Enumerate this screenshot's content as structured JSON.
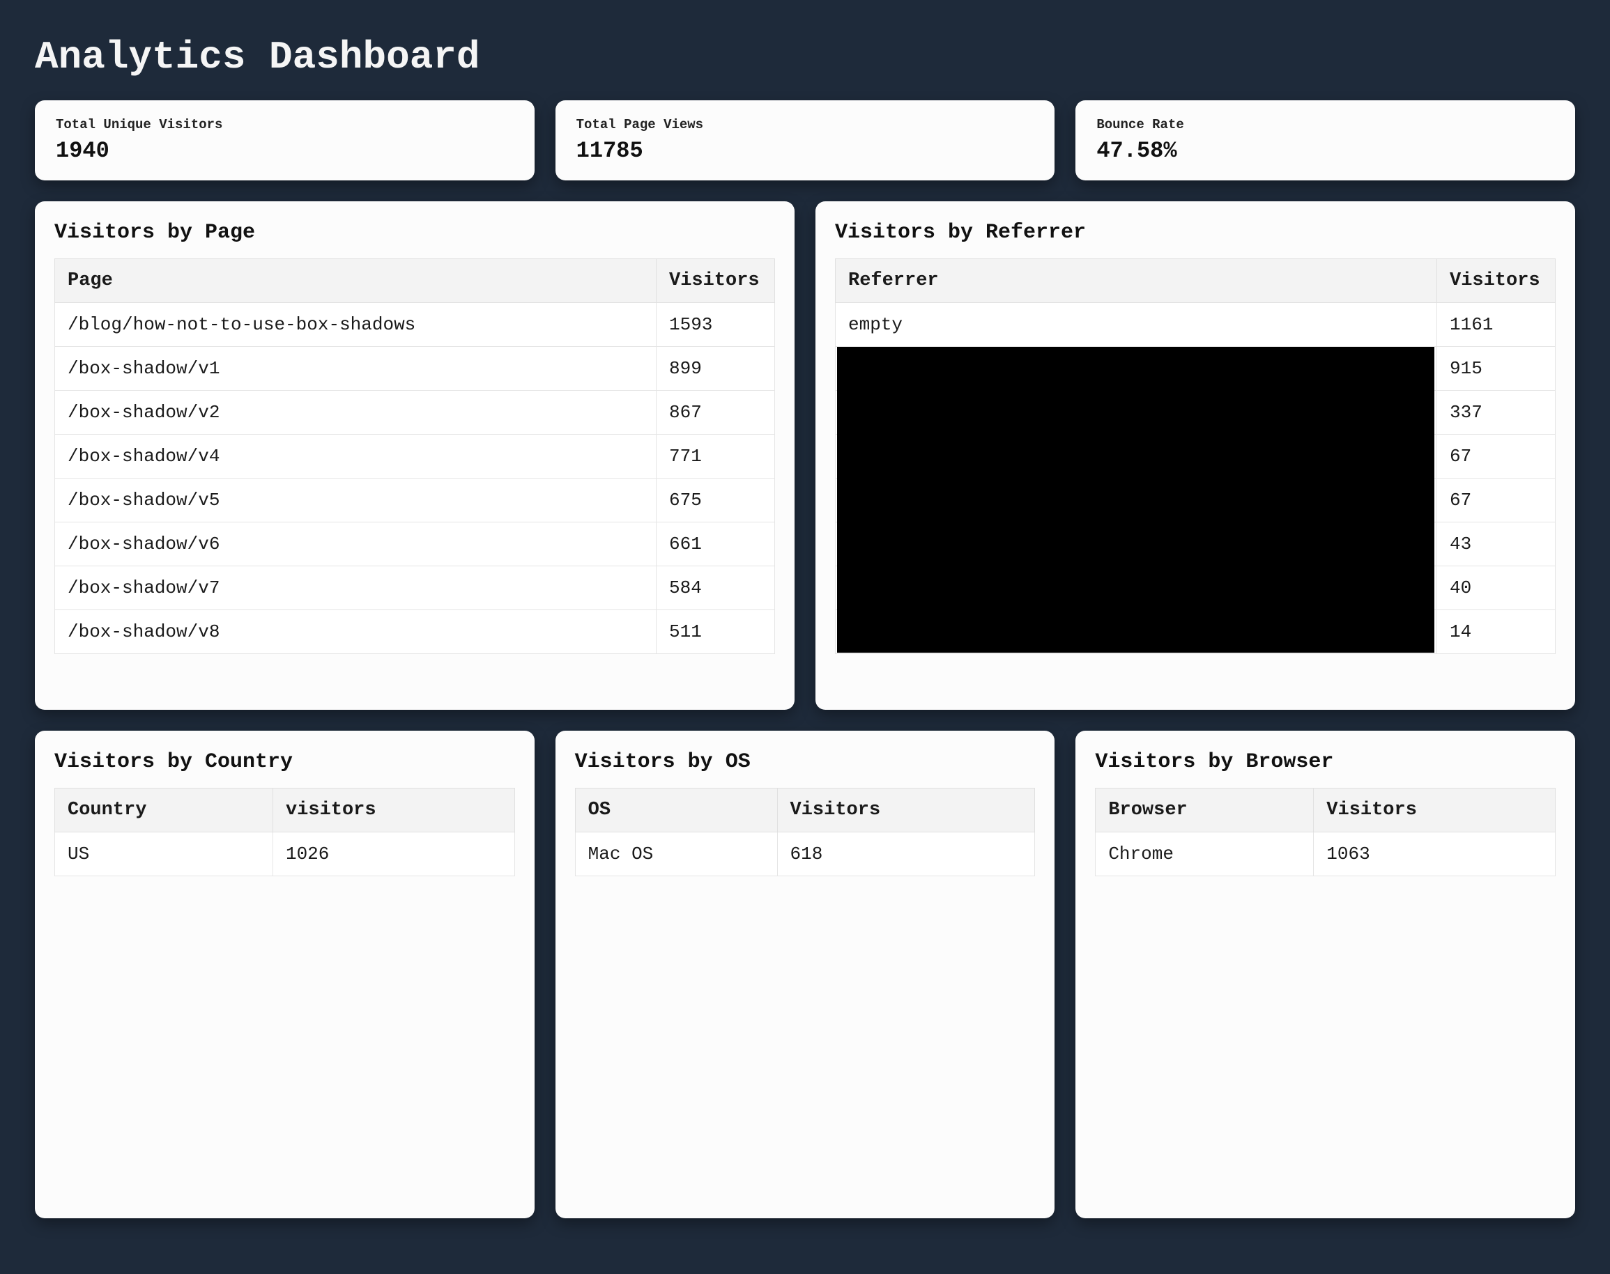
{
  "page_title": "Analytics Dashboard",
  "stats": {
    "visitors": {
      "label": "Total Unique Visitors",
      "value": "1940"
    },
    "pageviews": {
      "label": "Total Page Views",
      "value": "11785"
    },
    "bounce": {
      "label": "Bounce Rate",
      "value": "47.58%"
    }
  },
  "pages": {
    "title": "Visitors by Page",
    "header_a": "Page",
    "header_b": "Visitors",
    "rows": [
      {
        "a": "/blog/how-not-to-use-box-shadows",
        "b": "1593"
      },
      {
        "a": "/box-shadow/v1",
        "b": "899"
      },
      {
        "a": "/box-shadow/v2",
        "b": "867"
      },
      {
        "a": "/box-shadow/v4",
        "b": "771"
      },
      {
        "a": "/box-shadow/v5",
        "b": "675"
      },
      {
        "a": "/box-shadow/v6",
        "b": "661"
      },
      {
        "a": "/box-shadow/v7",
        "b": "584"
      },
      {
        "a": "/box-shadow/v8",
        "b": "511"
      }
    ]
  },
  "referrers": {
    "title": "Visitors by Referrer",
    "header_a": "Referrer",
    "header_b": "Visitors",
    "rows": [
      {
        "a": "empty",
        "b": "1161",
        "redacted": false
      },
      {
        "a": "",
        "b": "915",
        "redacted": true
      },
      {
        "a": "",
        "b": "337",
        "redacted": true
      },
      {
        "a": "",
        "b": "67",
        "redacted": true
      },
      {
        "a": "",
        "b": "67",
        "redacted": true
      },
      {
        "a": "",
        "b": "43",
        "redacted": true
      },
      {
        "a": "",
        "b": "40",
        "redacted": true
      },
      {
        "a": "",
        "b": "14",
        "redacted": true
      }
    ]
  },
  "country": {
    "title": "Visitors by Country",
    "header_a": "Country",
    "header_b": "visitors",
    "rows": [
      {
        "a": "US",
        "b": "1026"
      }
    ]
  },
  "os": {
    "title": "Visitors by OS",
    "header_a": "OS",
    "header_b": "Visitors",
    "rows": [
      {
        "a": "Mac OS",
        "b": "618"
      }
    ]
  },
  "browser": {
    "title": "Visitors by Browser",
    "header_a": "Browser",
    "header_b": "Visitors",
    "rows": [
      {
        "a": "Chrome",
        "b": "1063"
      }
    ]
  }
}
